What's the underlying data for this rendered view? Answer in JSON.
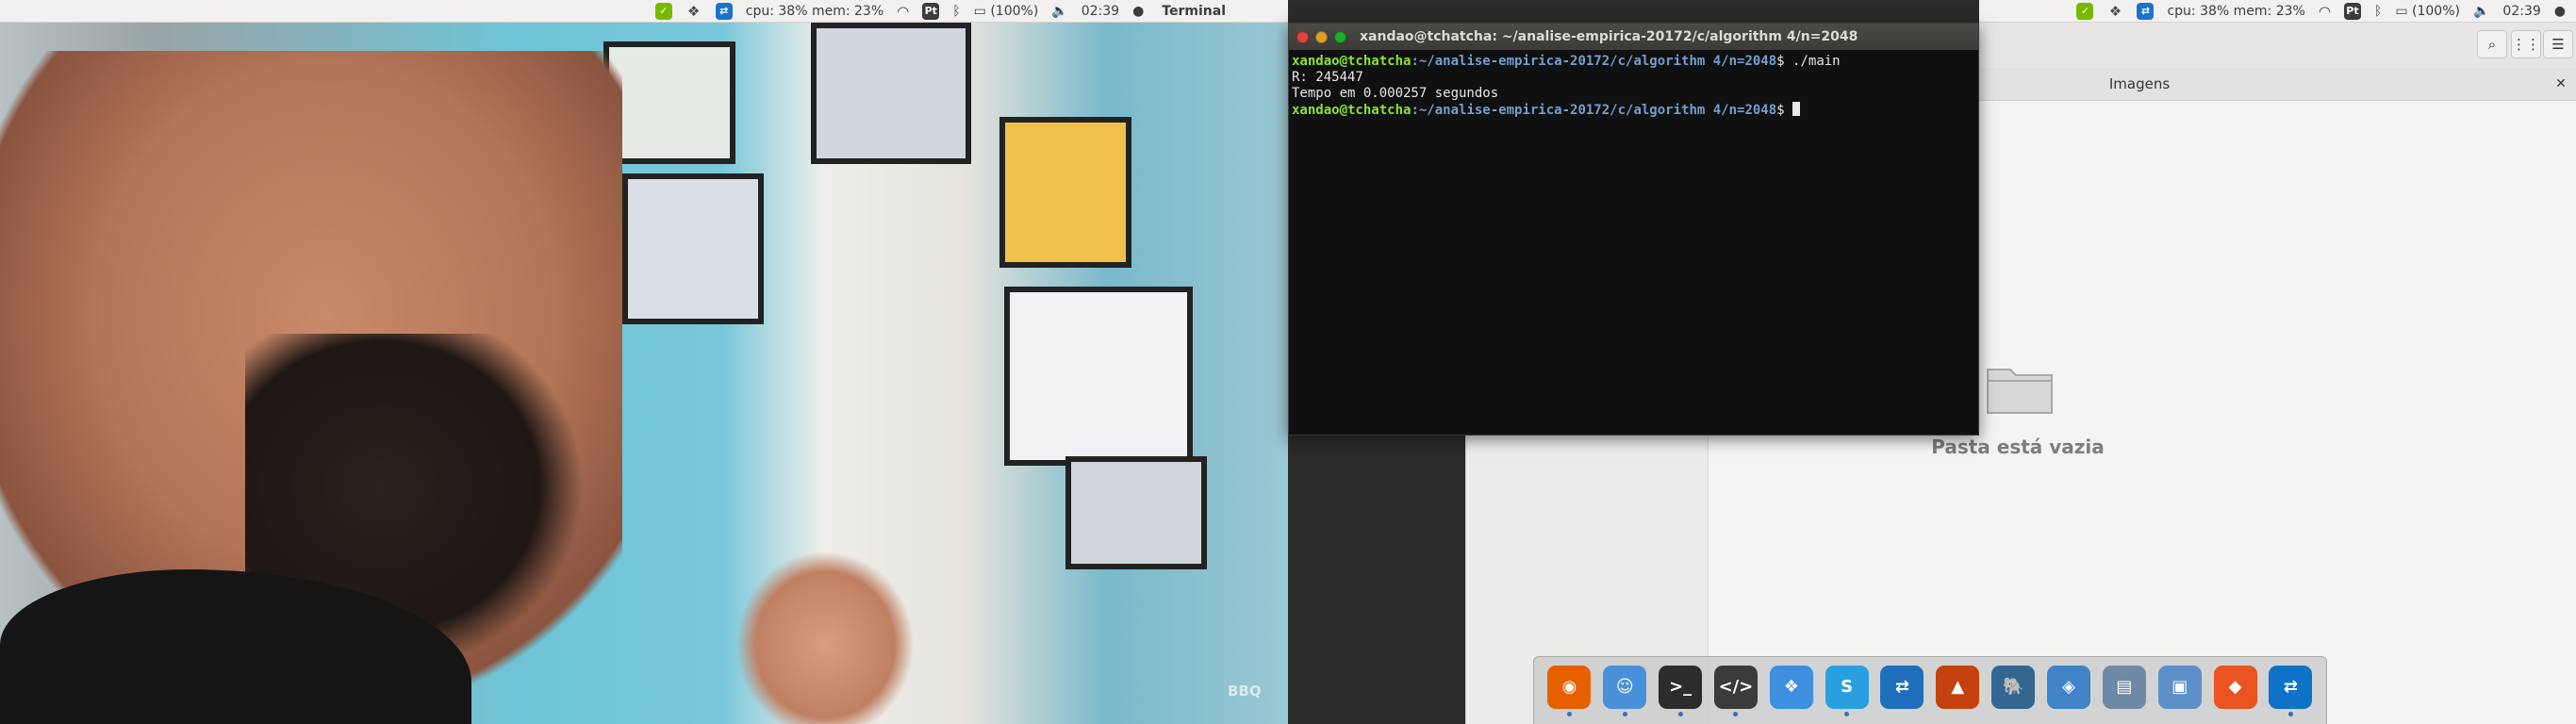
{
  "topbar_left": {
    "cpu_mem": "cpu: 38% mem: 23%",
    "pt": "Pt",
    "battery": "(100%)",
    "time": "02:39",
    "app_name": "Terminal"
  },
  "topbar_right": {
    "cpu_mem": "cpu: 38% mem: 23%",
    "pt": "Pt",
    "battery": "(100%)",
    "time": "02:39"
  },
  "terminal": {
    "title": "xandao@tchatcha: ~/analise-empirica-20172/c/algorithm 4/n=2048",
    "lines": [
      {
        "user": "xandao@tchatcha",
        "path": ":~/analise-empirica-20172/c/algorithm 4/n=2048",
        "cmd": "$ ./main"
      },
      {
        "text": "R: 245447"
      },
      {
        "text": "Tempo em 0.000257 segundos"
      },
      {
        "user": "xandao@tchatcha",
        "path": ":~/analise-empirica-20172/c/algorithm 4/n=2048",
        "cmd": "$ "
      }
    ]
  },
  "file_manager": {
    "tab_label": "Imagens",
    "empty_message": "Pasta está vazia",
    "close_glyph": "✕",
    "search_glyph": "⌕",
    "view_glyph": "⋮⋮",
    "menu_glyph": "☰"
  },
  "video": {
    "watermark": "BBQ"
  },
  "dock": {
    "items": [
      {
        "name": "firefox",
        "color": "#e66000",
        "glyph": "◉",
        "running": true
      },
      {
        "name": "finder",
        "color": "#4a90d9",
        "glyph": "☺",
        "running": true
      },
      {
        "name": "terminal",
        "color": "#2c2c2c",
        "glyph": ">_",
        "running": true
      },
      {
        "name": "code-editor",
        "color": "#3b3b3b",
        "glyph": "</>",
        "running": true
      },
      {
        "name": "dropbox",
        "color": "#3d8fe0",
        "glyph": "❖",
        "running": false
      },
      {
        "name": "skype",
        "color": "#2a9fe0",
        "glyph": "S",
        "running": true
      },
      {
        "name": "teamviewer",
        "color": "#1f6fbd",
        "glyph": "⇄",
        "running": false
      },
      {
        "name": "matlab",
        "color": "#c2410c",
        "glyph": "▲",
        "running": false
      },
      {
        "name": "postgres",
        "color": "#336791",
        "glyph": "🐘",
        "running": false
      },
      {
        "name": "mysql-workbench",
        "color": "#3f84c7",
        "glyph": "◈",
        "running": false
      },
      {
        "name": "remmina",
        "color": "#6f8aa6",
        "glyph": "▤",
        "running": false
      },
      {
        "name": "virtualbox",
        "color": "#5d8fc9",
        "glyph": "▣",
        "running": false
      },
      {
        "name": "ubuntu-software",
        "color": "#e95420",
        "glyph": "◆",
        "running": false
      },
      {
        "name": "teamviewer-2",
        "color": "#0e72c6",
        "glyph": "⇄",
        "running": true
      }
    ]
  }
}
